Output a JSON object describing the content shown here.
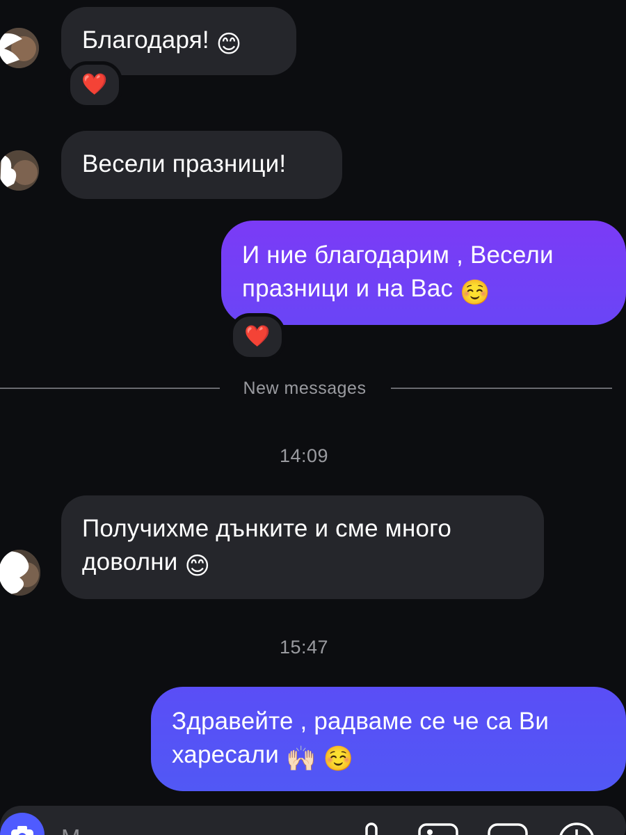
{
  "messages": [
    {
      "id": "m1",
      "direction": "incoming",
      "text": "Благодаря!",
      "emoji": "😊",
      "reaction": "❤️"
    },
    {
      "id": "m2",
      "direction": "incoming",
      "text": "Весели празници!"
    },
    {
      "id": "m3",
      "direction": "outgoing",
      "line1": "И ние благодарим , Весели",
      "line2": "празници и на Вас",
      "emoji": "☺️",
      "reaction": "❤️"
    },
    {
      "id": "m4",
      "direction": "incoming",
      "line1": "Получихме дънките и сме много",
      "line2": "доволни",
      "emoji": "😊"
    },
    {
      "id": "m5",
      "direction": "outgoing",
      "line1": "Здравейте , радваме се че са Ви",
      "line2": "харесали",
      "emoji1": "🙌🏻",
      "emoji2": "☺️"
    }
  ],
  "divider": {
    "label": "New messages"
  },
  "timestamps": {
    "t1": "14:09",
    "t2": "15:47"
  },
  "composer": {
    "placeholder": "M",
    "icons": [
      "camera-icon",
      "microphone-icon",
      "gallery-icon",
      "sticker-icon",
      "add-icon"
    ]
  },
  "colors": {
    "background": "#0c0d10",
    "incoming_bubble": "#25262b",
    "outgoing_gradient_top": "#7b3bf6",
    "outgoing_gradient_bottom": "#5158f5",
    "muted_text": "#9a9ba0"
  }
}
